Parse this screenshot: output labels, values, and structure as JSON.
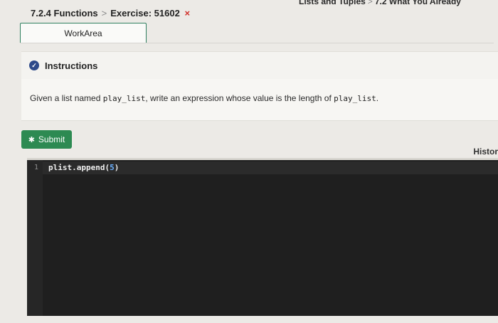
{
  "top_breadcrumb": {
    "partial_left": "Lists and Tuples",
    "current": "7.2 What You Already"
  },
  "breadcrumb": {
    "section": "7.2.4 Functions",
    "exercise": "Exercise: 51602",
    "close_glyph": "×"
  },
  "workarea": {
    "tab_label": "WorkArea"
  },
  "instructions": {
    "title": "Instructions",
    "text_before": "Given a list named ",
    "code_1": "play_list",
    "text_middle": ", write an expression whose value is the length of ",
    "code_2": "play_list",
    "text_after": "."
  },
  "submit": {
    "label": "Submit"
  },
  "history": {
    "label": "Histor"
  },
  "editor": {
    "line_number": "1",
    "code_prefix": "plist.append(",
    "code_number": "5",
    "code_suffix": ")"
  },
  "colors": {
    "submit_bg": "#2d8a52",
    "check_icon": "#2e4a8a",
    "close_x": "#d0302a",
    "editor_bg": "#1f1f1f"
  }
}
